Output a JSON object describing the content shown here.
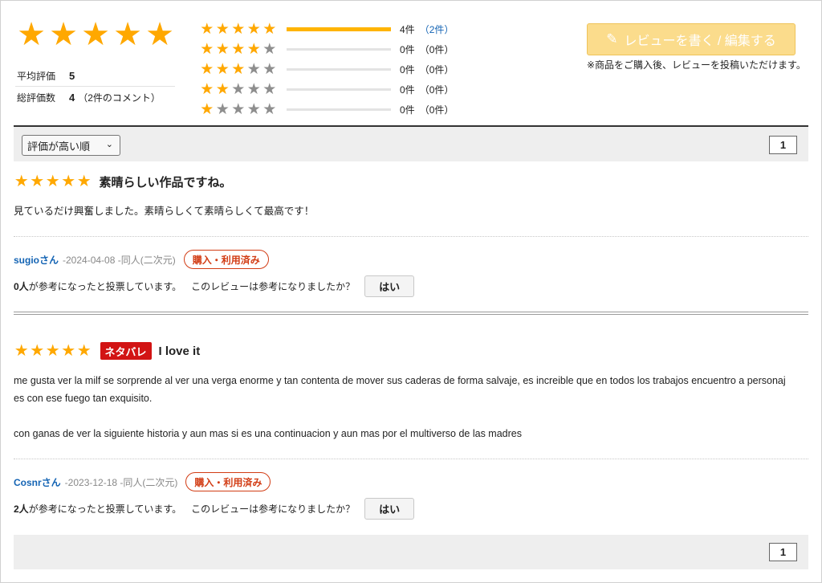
{
  "summary": {
    "average_label": "平均評価",
    "average_value": "5",
    "total_label": "総評価数",
    "total_value": "4",
    "total_comments": "（2件のコメント）",
    "distribution": [
      {
        "stars": 5,
        "count": "4件",
        "comments": "（2件）",
        "fill": 1.0
      },
      {
        "stars": 4,
        "count": "0件",
        "comments": "（0件）",
        "fill": 0
      },
      {
        "stars": 3,
        "count": "0件",
        "comments": "（0件）",
        "fill": 0
      },
      {
        "stars": 2,
        "count": "0件",
        "comments": "（0件）",
        "fill": 0
      },
      {
        "stars": 1,
        "count": "0件",
        "comments": "（0件）",
        "fill": 0
      }
    ],
    "write_button": "レビューを書く / 編集する",
    "write_note": "※商品をご購入後、レビューを投稿いただけます。"
  },
  "toolbar": {
    "sort_selected": "評価が高い順",
    "page": "1"
  },
  "reviews": [
    {
      "rating": 5,
      "spoiler": "",
      "title": "素晴らしい作品ですね。",
      "body": [
        "見ているだけ興奮しました。素晴らしくて素晴らしくて最高です！"
      ],
      "author": "sugioさん",
      "meta": "-2024-04-08 -同人(二次元)",
      "badge": "購入・利用済み",
      "helpful_count": "0人",
      "helpful_text": "が参考になったと投票しています。",
      "ask": "このレビューは参考になりましたか？",
      "yes": "はい"
    },
    {
      "rating": 5,
      "spoiler": "ネタバレ",
      "title": "I love it",
      "body": [
        "me gusta ver la milf se sorprende al ver una verga enorme y tan contenta de mover sus caderas de forma salvaje, es increible que en todos los trabajos encuentro a personaj",
        "es con ese fuego tan exquisito.",
        "con ganas de ver la siguiente historia y aun mas si es una continuacion y aun mas por el multiverso de las madres"
      ],
      "author": "Cosnrさん",
      "meta": "-2023-12-18 -同人(二次元)",
      "badge": "購入・利用済み",
      "helpful_count": "2人",
      "helpful_text": "が参考になったと投票しています。",
      "ask": "このレビューは参考になりましたか？",
      "yes": "はい"
    }
  ],
  "footer": {
    "page": "1"
  },
  "colors": {
    "star": "#ffa800",
    "link": "#1464b4",
    "badge": "#d23c14",
    "spoiler": "#d21414"
  }
}
